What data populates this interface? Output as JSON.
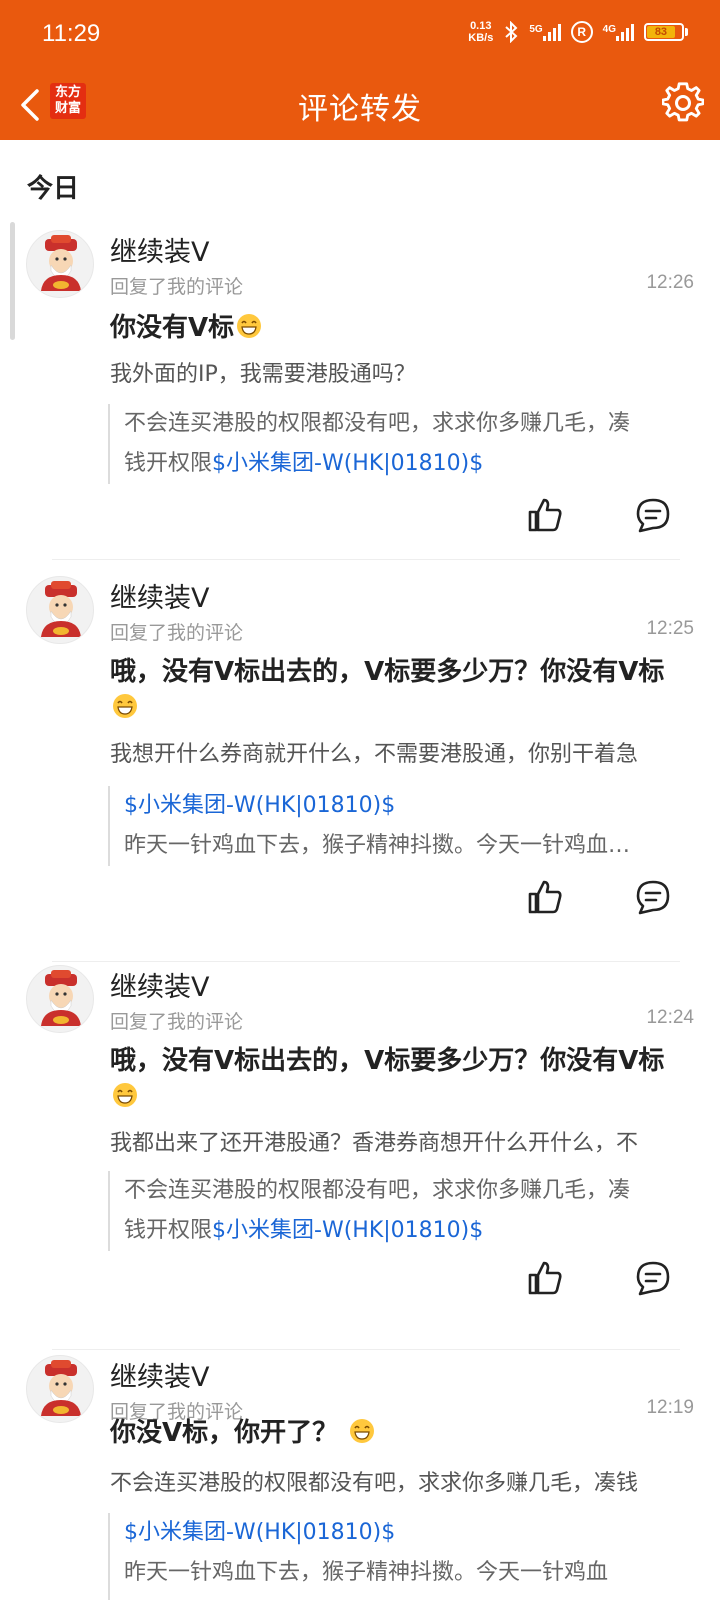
{
  "status_bar": {
    "time": "11:29",
    "net_speed_value": "0.13",
    "net_speed_unit": "KB/s",
    "signal_1_tag": "5G",
    "signal_2_tag": "4G",
    "r_badge": "R",
    "battery": "83"
  },
  "header": {
    "title": "评论转发",
    "logo_line1": "东方",
    "logo_line2": "财富"
  },
  "section": {
    "title": "今日"
  },
  "items": [
    {
      "username": "继续装V",
      "subline": "回复了我的评论",
      "time": "12:26",
      "comment": "你没有V标",
      "parent": "我外面的IP，我需要港股通吗？",
      "quote_line1": "不会连买港股的权限都没有吧，求求你多赚几毛，凑",
      "quote_line2": "钱开权限",
      "quote_link": "$小米集团-W(HK|01810)$"
    },
    {
      "username": "继续装V",
      "subline": "回复了我的评论",
      "time": "12:25",
      "comment": "哦，没有V标出去的，V标要多少万？你没有V标",
      "parent": "我想开什么券商就开什么，不需要港股通，你别干着急",
      "quote_link": "$小米集团-W(HK|01810)$",
      "quote_line2": "昨天一针鸡血下去，猴子精神抖擞。今天一针鸡血…"
    },
    {
      "username": "继续装V",
      "subline": "回复了我的评论",
      "time": "12:24",
      "comment": "哦，没有V标出去的，V标要多少万？你没有V标",
      "parent": "我都出来了还开港股通？香港券商想开什么开什么，不",
      "quote_line1": "不会连买港股的权限都没有吧，求求你多赚几毛，凑",
      "quote_line2": "钱开权限",
      "quote_link": "$小米集团-W(HK|01810)$"
    },
    {
      "username": "继续装V",
      "subline": "回复了我的评论",
      "time": "12:19",
      "comment": "你没V标，你开了？",
      "parent": "不会连买港股的权限都没有吧，求求你多赚几毛，凑钱",
      "quote_link": "$小米集团-W(HK|01810)$",
      "quote_line2": "昨天一针鸡血下去，猴子精神抖擞。今天一针鸡血"
    }
  ],
  "colors": {
    "brand": "#e9590e",
    "link": "#1a66d6"
  },
  "icons": {
    "back": "chevron-left-icon",
    "settings": "gear-icon",
    "like": "thumbs-up-icon",
    "reply": "comment-icon",
    "emoji": "grin-emoji-icon"
  }
}
